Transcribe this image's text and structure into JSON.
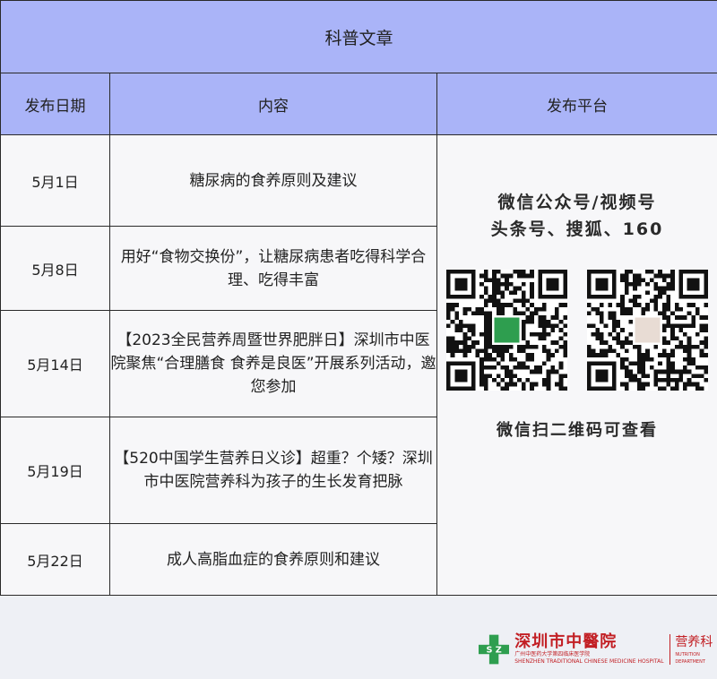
{
  "table": {
    "title": "科普文章",
    "headers": [
      "发布日期",
      "内容",
      "发布平台"
    ],
    "rows": [
      {
        "date": "5月1日",
        "content": "糖尿病的食养原则及建议"
      },
      {
        "date": "5月8日",
        "content": "用好“食物交换份”，让糖尿病患者吃得科学合理、吃得丰富"
      },
      {
        "date": "5月14日",
        "content": "【2023全民营养周暨世界肥胖日】深圳市中医院聚焦“合理膳食 食养是良医”开展系列活动，邀您参加"
      },
      {
        "date": "5月19日",
        "content": "【520中国学生营养日义诊】超重？个矮？深圳市中医院营养科为孩子的生长发育把脉"
      },
      {
        "date": "5月22日",
        "content": "成人高脂血症的食养原则和建议"
      }
    ],
    "platform": {
      "line1": "微信公众号/视频号",
      "line2": "头条号、搜狐、160",
      "scan_text": "微信扫二维码可查看"
    }
  },
  "footer": {
    "hospital_name": "深圳市中醫院",
    "hospital_sub_cn": "广州中医药大学第四临床医学院",
    "hospital_sub_en": "SHENZHEN TRADITIONAL CHINESE MEDICINE HOSPITAL",
    "department": "营养科",
    "department_en": "NUTRITION DEPARTMENT"
  },
  "colors": {
    "header_bg": "#aab4f8",
    "cell_bg": "#f7f7f9",
    "logo_green": "#2e9e4f",
    "logo_red": "#c21f24"
  }
}
